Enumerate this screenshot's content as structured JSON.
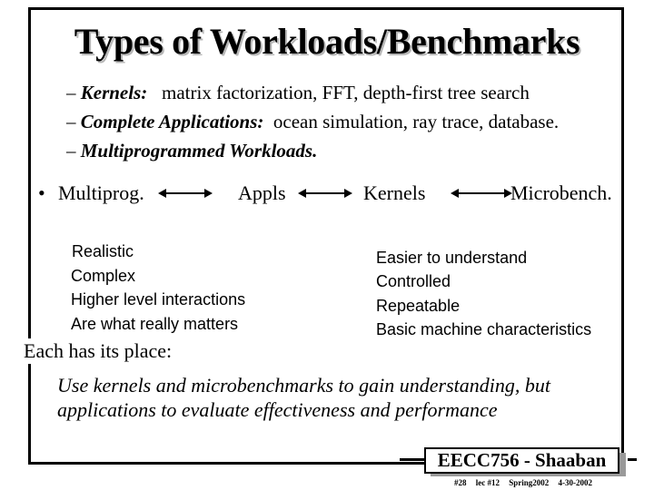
{
  "slide": {
    "title": "Types of Workloads/Benchmarks",
    "sub_bullets": [
      {
        "dash": "–",
        "lead": "Kernels:",
        "text": "matrix factorization, FFT, depth-first tree search"
      },
      {
        "dash": "–",
        "lead": "Complete Applications:",
        "text": "ocean simulation, ray trace, database."
      },
      {
        "dash": "–",
        "lead": "Multiprogrammed Workloads.",
        "text": ""
      }
    ],
    "spectrum": {
      "bullet": "•",
      "items": [
        "Multiprog.",
        "Appls",
        "Kernels",
        "Microbench."
      ],
      "arrow_icon": "double-headed-arrow"
    },
    "left_traits": [
      "Realistic",
      "Complex",
      "Higher level interactions",
      "Are what really matters"
    ],
    "right_traits": [
      "Easier to understand",
      "Controlled",
      "Repeatable",
      "Basic machine characteristics"
    ],
    "each_has_place": "Each has its place:",
    "conclusion": [
      "Use kernels and microbenchmarks to gain understanding, but",
      "applications to evaluate effectiveness and performance"
    ]
  },
  "footer": {
    "course": "EECC756 - Shaaban",
    "slide_number": "#28",
    "lecture": "lec #12",
    "term": "Spring2002",
    "date": "4-30-2002"
  }
}
